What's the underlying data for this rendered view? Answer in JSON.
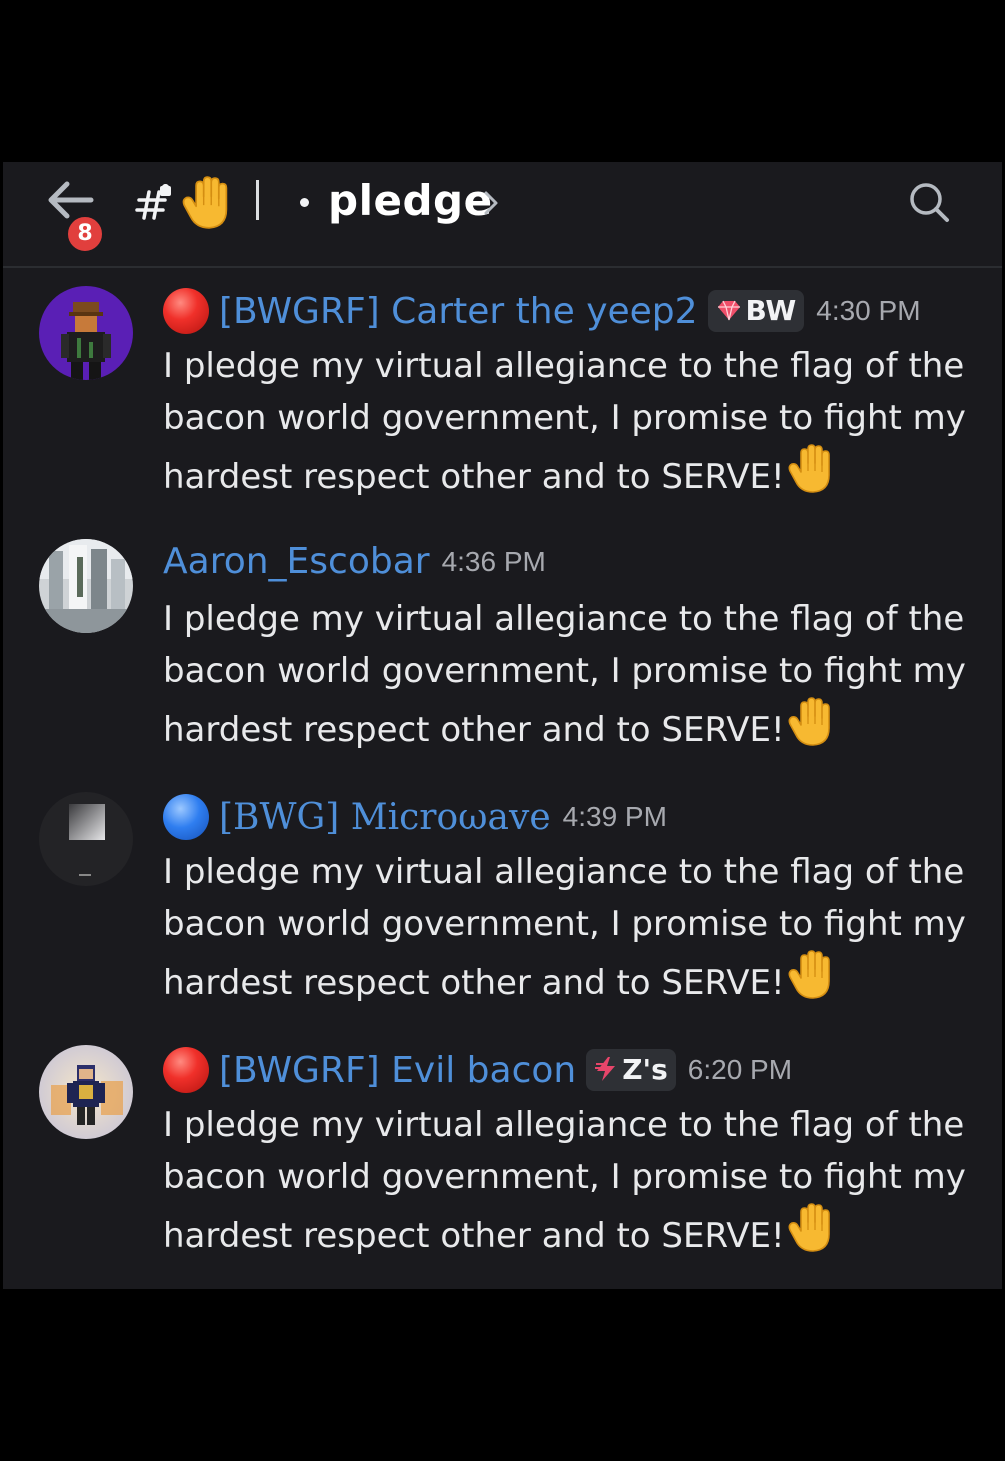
{
  "header": {
    "back_badge": "8",
    "channel_prefix_icon": "text-channel-locked-icon",
    "channel_emoji": "raised-hand-icon",
    "channel_name": "pledge",
    "search_icon": "search-icon"
  },
  "messages": [
    {
      "status_icon": "red-circle-icon",
      "username": "[BWGRF] Carter the yeep2",
      "username_color": "#4f8fd9",
      "tag": {
        "icon": "gem-icon",
        "label": "BW"
      },
      "time": "4:30 PM",
      "lines": [
        "I pledge my virtual allegiance to the flag of the",
        "bacon world government, I promise to fight my",
        "hardest respect other and to SERVE!"
      ]
    },
    {
      "status_icon": "",
      "username": "Aaron_Escobar",
      "username_color": "#4f8fd9",
      "tag": null,
      "time": "4:36 PM",
      "lines": [
        "I pledge my virtual allegiance to the flag of the",
        "bacon world government, I promise to fight my",
        "hardest respect other and to SERVE!"
      ]
    },
    {
      "status_icon": "blue-circle-icon",
      "username": "[BWG] Microωave",
      "username_color": "#4f8fd9",
      "tag": null,
      "time": "4:39 PM",
      "lines": [
        "I pledge my virtual allegiance to the flag of the",
        "bacon world government, I promise to fight my",
        "hardest respect other and to SERVE!"
      ]
    },
    {
      "status_icon": "red-circle-icon",
      "username": "[BWGRF] Evil bacon",
      "username_color": "#4f8fd9",
      "tag": {
        "icon": "lightning-icon",
        "label": "Z's"
      },
      "time": "6:20 PM",
      "lines": [
        "I pledge my virtual allegiance to the flag of the",
        "bacon world government, I promise to fight my",
        "hardest respect other and to SERVE!"
      ]
    }
  ],
  "colors": {
    "background": "#1a1a1e",
    "username": "#4f8fd9",
    "badge": "#e13f3d"
  }
}
